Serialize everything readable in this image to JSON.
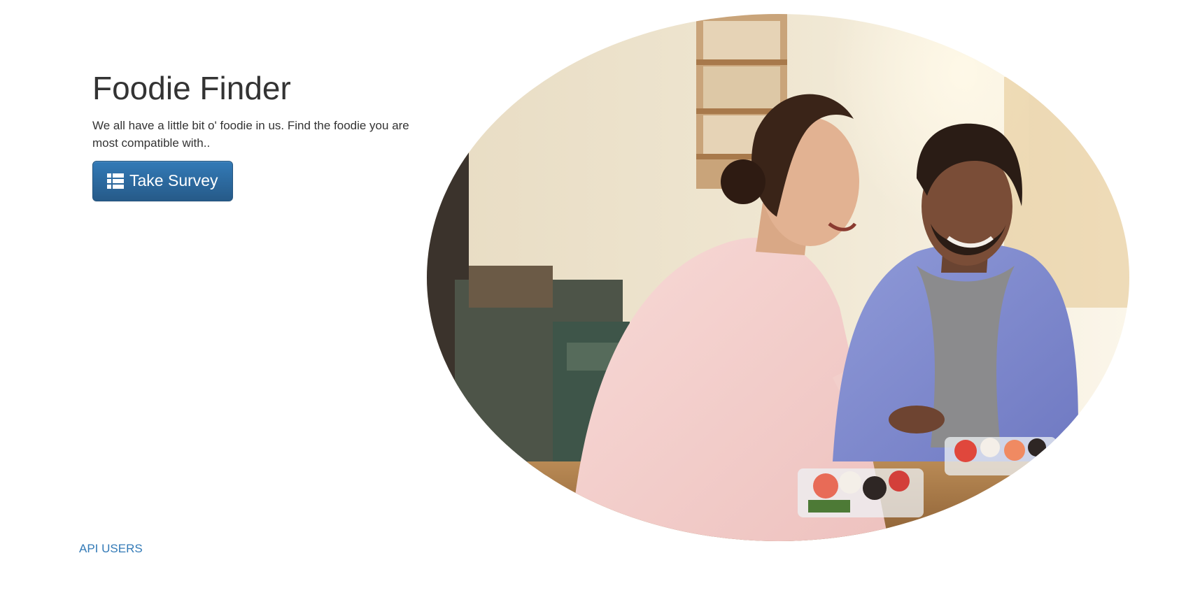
{
  "hero": {
    "title": "Foodie Finder",
    "tagline": "We all have a little bit o' foodie in us. Find the foodie you are most compatible with..",
    "survey_button_label": "Take Survey",
    "survey_button_icon": "list-icon",
    "image_description": "Woman in a pink sweater and man in a blue hoodie laughing while eating sushi at a kitchen table"
  },
  "footer": {
    "api_users_link": "API USERS"
  },
  "colors": {
    "primary": "#337ab7",
    "primary_dark": "#265a88",
    "text": "#333333",
    "link": "#337ab7"
  }
}
